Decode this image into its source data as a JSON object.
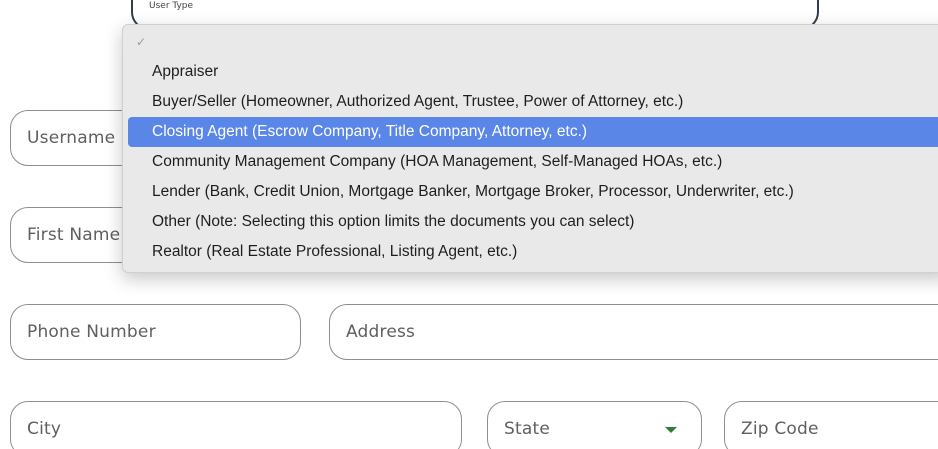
{
  "form": {
    "user_type": {
      "floating_label": "User Type"
    },
    "username": {
      "placeholder": "Username"
    },
    "first_name": {
      "placeholder": "First Name"
    },
    "phone": {
      "placeholder": "Phone Number"
    },
    "address": {
      "placeholder": "Address"
    },
    "city": {
      "placeholder": "City"
    },
    "state": {
      "placeholder": "State"
    },
    "zip": {
      "placeholder": "Zip Code"
    }
  },
  "dropdown": {
    "check_glyph": "✓",
    "selected_index": 2,
    "options": [
      "Appraiser",
      "Buyer/Seller (Homeowner, Authorized Agent, Trustee, Power of Attorney, etc.)",
      "Closing Agent (Escrow Company, Title Company, Attorney, etc.)",
      "Community Management Company (HOA Management, Self-Managed HOAs, etc.)",
      "Lender (Bank, Credit Union, Mortgage Banker, Mortgage Broker, Processor, Underwriter, etc.)",
      "Other (Note: Selecting this option limits the documents you can select)",
      "Realtor (Real Estate Professional, Listing Agent, etc.)"
    ]
  },
  "colors": {
    "highlight": "#5a86e8",
    "caret": "#2e7d3a",
    "field_border": "#8e8e8e"
  }
}
